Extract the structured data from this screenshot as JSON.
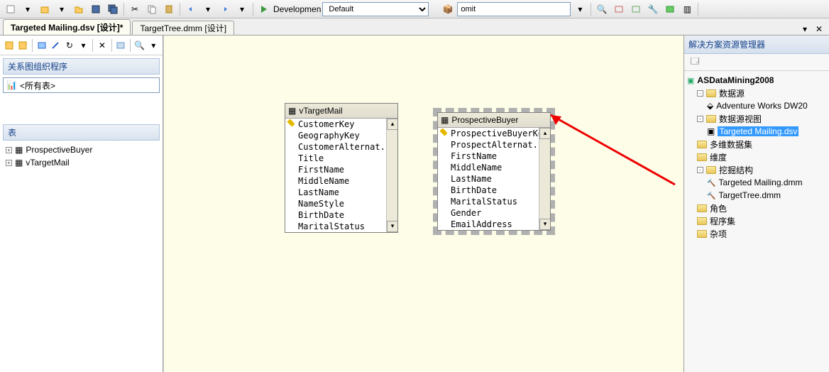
{
  "toolbar": {
    "run_label": "Developmen",
    "config": "Default",
    "project": "omit"
  },
  "tabs": {
    "active": "Targeted Mailing.dsv [设计]*",
    "other": "TargetTree.dmm [设计]"
  },
  "leftpanel": {
    "organizer_title": "关系图组织程序",
    "all_tables": "<所有表>",
    "tables_header": "表",
    "tables": [
      "ProspectiveBuyer",
      "vTargetMail"
    ]
  },
  "designer": {
    "widget1": {
      "title": "vTargetMail",
      "columns": [
        "CustomerKey",
        "GeographyKey",
        "CustomerAlternat...",
        "Title",
        "FirstName",
        "MiddleName",
        "LastName",
        "NameStyle",
        "BirthDate",
        "MaritalStatus"
      ],
      "keycol": 0
    },
    "widget2": {
      "title": "ProspectiveBuyer",
      "columns": [
        "ProspectiveBuyerKey",
        "ProspectAlternat...",
        "FirstName",
        "MiddleName",
        "LastName",
        "BirthDate",
        "MaritalStatus",
        "Gender",
        "EmailAddress"
      ],
      "keycol": 0
    }
  },
  "solution": {
    "title": "解决方案资源管理器",
    "project": "ASDataMining2008",
    "folders": {
      "datasources": "数据源",
      "ds_item": "Adventure Works DW20",
      "dsv": "数据源视图",
      "dsv_item": "Targeted Mailing.dsv",
      "cubes": "多维数据集",
      "dims": "维度",
      "mining": "挖掘结构",
      "mining_items": [
        "Targeted Mailing.dmm",
        "TargetTree.dmm"
      ],
      "roles": "角色",
      "assemblies": "程序集",
      "misc": "杂项"
    }
  }
}
